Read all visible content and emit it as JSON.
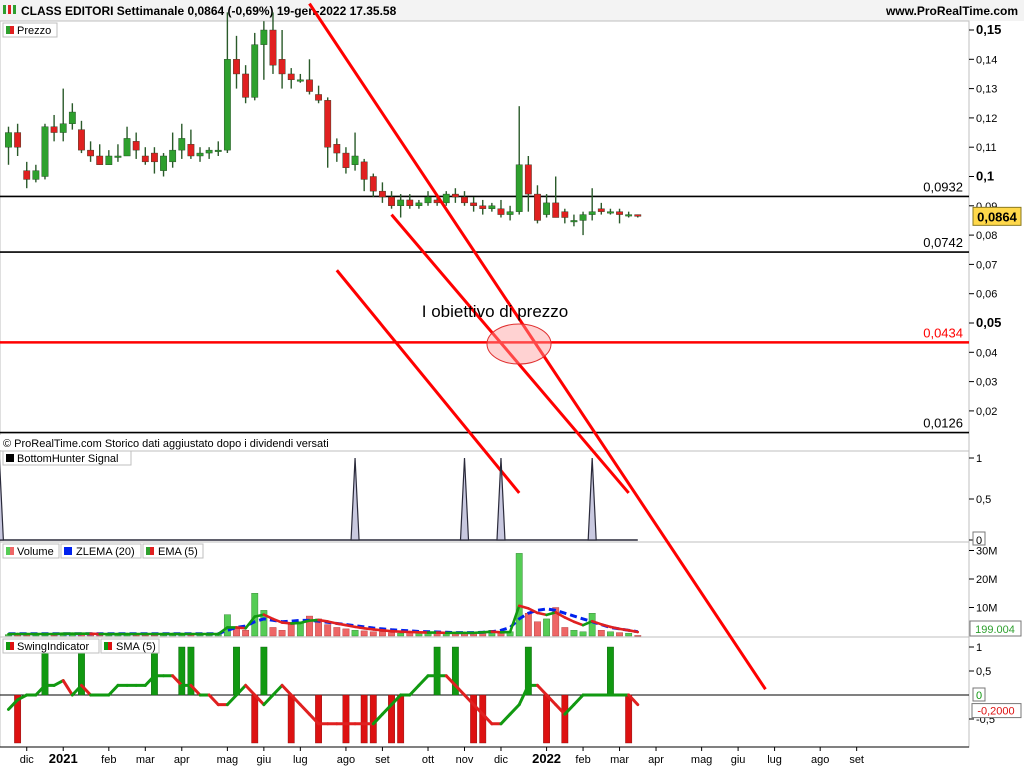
{
  "header": {
    "title": "CLASS EDITORI Settimanale 0,0864 (-0,69%) 19-gen-2022 17.35.58",
    "site": "www.ProRealTime.com"
  },
  "colors": {
    "up": "#2ea02e",
    "down": "#e02020",
    "channel": "#ff0000",
    "level": "#000000",
    "price_badge": "#ffd84a",
    "zlema": "#0022ee",
    "volume_up": "#55cc55",
    "volume_down": "#ee6666",
    "swing_up": "#119911",
    "swing_down": "#dd1111",
    "bottom_fill": "#c9c9e0"
  },
  "chart_data": [
    {
      "type": "candlestick",
      "panel": "Prezzo",
      "legend": [
        "Prezzo"
      ],
      "ylim": [
        0.0,
        0.15
      ],
      "yticks": [
        0.02,
        0.03,
        0.04,
        0.05,
        0.06,
        0.07,
        0.08,
        0.09,
        0.1,
        0.11,
        0.12,
        0.13,
        0.14,
        0.15
      ],
      "ytick_labels": [
        "0,02",
        "0,03",
        "0,04",
        "0,05",
        "0,06",
        "0,07",
        "0,08",
        "0,09",
        "0,1",
        "0,11",
        "0,12",
        "0,13",
        "0,14",
        "0,15"
      ],
      "bold_ticks": [
        0.05,
        0.1,
        0.15
      ],
      "last_price": 0.0864,
      "last_price_label": "0,0864",
      "levels": [
        {
          "value": 0.0932,
          "label": "0,0932",
          "color": "#000000"
        },
        {
          "value": 0.0742,
          "label": "0,0742",
          "color": "#000000"
        },
        {
          "value": 0.0434,
          "label": "0,0434",
          "color": "#ff0000"
        },
        {
          "value": 0.0126,
          "label": "0,0126",
          "color": "#000000"
        }
      ],
      "annotation": {
        "text": "I obiettivo di prezzo",
        "target_value": 0.0434
      },
      "footnote": "© ProRealTime.com Storico dati aggiustato dopo i dividendi versati",
      "candles": [
        {
          "o": 0.11,
          "h": 0.117,
          "l": 0.104,
          "c": 0.115
        },
        {
          "o": 0.115,
          "h": 0.118,
          "l": 0.107,
          "c": 0.11
        },
        {
          "o": 0.102,
          "h": 0.105,
          "l": 0.096,
          "c": 0.099
        },
        {
          "o": 0.099,
          "h": 0.104,
          "l": 0.098,
          "c": 0.102
        },
        {
          "o": 0.1,
          "h": 0.118,
          "l": 0.099,
          "c": 0.117
        },
        {
          "o": 0.117,
          "h": 0.121,
          "l": 0.112,
          "c": 0.115
        },
        {
          "o": 0.115,
          "h": 0.13,
          "l": 0.112,
          "c": 0.118
        },
        {
          "o": 0.118,
          "h": 0.125,
          "l": 0.116,
          "c": 0.122
        },
        {
          "o": 0.116,
          "h": 0.119,
          "l": 0.108,
          "c": 0.109
        },
        {
          "o": 0.109,
          "h": 0.112,
          "l": 0.105,
          "c": 0.107
        },
        {
          "o": 0.107,
          "h": 0.111,
          "l": 0.104,
          "c": 0.104
        },
        {
          "o": 0.104,
          "h": 0.109,
          "l": 0.104,
          "c": 0.107
        },
        {
          "o": 0.107,
          "h": 0.111,
          "l": 0.105,
          "c": 0.107
        },
        {
          "o": 0.107,
          "h": 0.117,
          "l": 0.107,
          "c": 0.113
        },
        {
          "o": 0.112,
          "h": 0.115,
          "l": 0.106,
          "c": 0.109
        },
        {
          "o": 0.107,
          "h": 0.11,
          "l": 0.104,
          "c": 0.105
        },
        {
          "o": 0.108,
          "h": 0.11,
          "l": 0.101,
          "c": 0.105
        },
        {
          "o": 0.102,
          "h": 0.108,
          "l": 0.1,
          "c": 0.107
        },
        {
          "o": 0.105,
          "h": 0.115,
          "l": 0.103,
          "c": 0.109
        },
        {
          "o": 0.109,
          "h": 0.118,
          "l": 0.106,
          "c": 0.113
        },
        {
          "o": 0.111,
          "h": 0.116,
          "l": 0.106,
          "c": 0.107
        },
        {
          "o": 0.107,
          "h": 0.11,
          "l": 0.105,
          "c": 0.108
        },
        {
          "o": 0.108,
          "h": 0.11,
          "l": 0.106,
          "c": 0.109
        },
        {
          "o": 0.109,
          "h": 0.112,
          "l": 0.107,
          "c": 0.109
        },
        {
          "o": 0.109,
          "h": 0.156,
          "l": 0.108,
          "c": 0.14
        },
        {
          "o": 0.14,
          "h": 0.148,
          "l": 0.13,
          "c": 0.135
        },
        {
          "o": 0.135,
          "h": 0.138,
          "l": 0.125,
          "c": 0.127
        },
        {
          "o": 0.127,
          "h": 0.149,
          "l": 0.126,
          "c": 0.145
        },
        {
          "o": 0.145,
          "h": 0.153,
          "l": 0.133,
          "c": 0.15
        },
        {
          "o": 0.15,
          "h": 0.156,
          "l": 0.135,
          "c": 0.138
        },
        {
          "o": 0.14,
          "h": 0.15,
          "l": 0.13,
          "c": 0.135
        },
        {
          "o": 0.135,
          "h": 0.137,
          "l": 0.13,
          "c": 0.133
        },
        {
          "o": 0.133,
          "h": 0.135,
          "l": 0.132,
          "c": 0.133
        },
        {
          "o": 0.133,
          "h": 0.14,
          "l": 0.128,
          "c": 0.129
        },
        {
          "o": 0.128,
          "h": 0.131,
          "l": 0.125,
          "c": 0.126
        },
        {
          "o": 0.126,
          "h": 0.127,
          "l": 0.103,
          "c": 0.11
        },
        {
          "o": 0.111,
          "h": 0.113,
          "l": 0.105,
          "c": 0.108
        },
        {
          "o": 0.108,
          "h": 0.11,
          "l": 0.101,
          "c": 0.103
        },
        {
          "o": 0.104,
          "h": 0.115,
          "l": 0.102,
          "c": 0.107
        },
        {
          "o": 0.105,
          "h": 0.106,
          "l": 0.095,
          "c": 0.099
        },
        {
          "o": 0.1,
          "h": 0.101,
          "l": 0.093,
          "c": 0.095
        },
        {
          "o": 0.095,
          "h": 0.098,
          "l": 0.091,
          "c": 0.093
        },
        {
          "o": 0.093,
          "h": 0.095,
          "l": 0.089,
          "c": 0.09
        },
        {
          "o": 0.09,
          "h": 0.094,
          "l": 0.086,
          "c": 0.092
        },
        {
          "o": 0.092,
          "h": 0.094,
          "l": 0.089,
          "c": 0.09
        },
        {
          "o": 0.09,
          "h": 0.092,
          "l": 0.089,
          "c": 0.091
        },
        {
          "o": 0.091,
          "h": 0.095,
          "l": 0.09,
          "c": 0.093
        },
        {
          "o": 0.092,
          "h": 0.094,
          "l": 0.09,
          "c": 0.091
        },
        {
          "o": 0.091,
          "h": 0.095,
          "l": 0.09,
          "c": 0.094
        },
        {
          "o": 0.094,
          "h": 0.096,
          "l": 0.091,
          "c": 0.093
        },
        {
          "o": 0.093,
          "h": 0.095,
          "l": 0.09,
          "c": 0.091
        },
        {
          "o": 0.091,
          "h": 0.093,
          "l": 0.088,
          "c": 0.09
        },
        {
          "o": 0.09,
          "h": 0.092,
          "l": 0.087,
          "c": 0.089
        },
        {
          "o": 0.089,
          "h": 0.091,
          "l": 0.088,
          "c": 0.09
        },
        {
          "o": 0.089,
          "h": 0.092,
          "l": 0.086,
          "c": 0.087
        },
        {
          "o": 0.087,
          "h": 0.09,
          "l": 0.085,
          "c": 0.088
        },
        {
          "o": 0.088,
          "h": 0.124,
          "l": 0.087,
          "c": 0.104
        },
        {
          "o": 0.104,
          "h": 0.107,
          "l": 0.088,
          "c": 0.094
        },
        {
          "o": 0.094,
          "h": 0.097,
          "l": 0.084,
          "c": 0.085
        },
        {
          "o": 0.087,
          "h": 0.094,
          "l": 0.086,
          "c": 0.091
        },
        {
          "o": 0.091,
          "h": 0.1,
          "l": 0.086,
          "c": 0.086
        },
        {
          "o": 0.088,
          "h": 0.089,
          "l": 0.084,
          "c": 0.086
        },
        {
          "o": 0.085,
          "h": 0.087,
          "l": 0.083,
          "c": 0.085
        },
        {
          "o": 0.085,
          "h": 0.088,
          "l": 0.08,
          "c": 0.087
        },
        {
          "o": 0.087,
          "h": 0.096,
          "l": 0.085,
          "c": 0.088
        },
        {
          "o": 0.089,
          "h": 0.091,
          "l": 0.087,
          "c": 0.088
        },
        {
          "o": 0.088,
          "h": 0.089,
          "l": 0.087,
          "c": 0.088
        },
        {
          "o": 0.088,
          "h": 0.089,
          "l": 0.084,
          "c": 0.087
        },
        {
          "o": 0.087,
          "h": 0.088,
          "l": 0.086,
          "c": 0.087
        },
        {
          "o": 0.087,
          "h": 0.087,
          "l": 0.086,
          "c": 0.0864
        }
      ],
      "channel_lines": [
        {
          "from": {
            "week": 33,
            "value": 0.159
          },
          "to": {
            "week": 83,
            "value": -0.075
          }
        },
        {
          "from": {
            "week": 42,
            "value": 0.087
          },
          "to": {
            "week": 68,
            "value": -0.008
          }
        },
        {
          "from": {
            "week": 36,
            "value": 0.068
          },
          "to": {
            "week": 56,
            "value": -0.008
          }
        }
      ]
    },
    {
      "type": "area",
      "panel": "BottomHunter Signal",
      "legend": [
        "BottomHunter Signal"
      ],
      "ylim": [
        0,
        1
      ],
      "ytick_labels": [
        "1",
        "0,5",
        "0"
      ],
      "spikes_at_week": [
        -1,
        38,
        50,
        54,
        64
      ],
      "series_length": 70
    },
    {
      "type": "bar",
      "panel": "Volume",
      "legend": [
        "Volume",
        "ZLEMA (20)",
        "EMA (5)"
      ],
      "ylim": [
        0,
        30
      ],
      "unit": "M",
      "ytick_labels": [
        "30M",
        "20M",
        "10M"
      ],
      "last_value_label": "199.004",
      "volume": [
        0.5,
        0.8,
        0.6,
        0.7,
        0.6,
        0.9,
        1.0,
        0.8,
        0.9,
        0.7,
        0.6,
        0.7,
        0.8,
        0.7,
        0.6,
        0.8,
        0.7,
        0.6,
        0.9,
        0.8,
        0.7,
        0.6,
        0.7,
        0.8,
        7.5,
        3.0,
        2.0,
        15.0,
        9.0,
        3.0,
        2.0,
        4.0,
        5.0,
        7.0,
        6.0,
        4.0,
        3.0,
        2.5,
        2.0,
        1.8,
        1.5,
        1.5,
        1.2,
        1.0,
        1.2,
        1.1,
        1.0,
        1.2,
        1.0,
        0.9,
        1.0,
        1.2,
        1.5,
        2.0,
        1.0,
        1.5,
        29.0,
        8.0,
        5.0,
        6.0,
        10.0,
        3.0,
        2.0,
        1.5,
        8.0,
        2.0,
        1.5,
        1.2,
        1.0,
        0.2
      ],
      "zlema": [
        0.8,
        0.8,
        0.8,
        0.8,
        0.8,
        0.8,
        0.8,
        0.8,
        0.8,
        0.8,
        0.8,
        0.8,
        0.8,
        0.8,
        0.8,
        0.8,
        0.8,
        0.8,
        0.8,
        0.8,
        0.8,
        0.8,
        0.8,
        0.8,
        2.0,
        3.0,
        3.5,
        5.0,
        6.0,
        5.5,
        5.0,
        5.2,
        5.5,
        5.5,
        5.2,
        4.8,
        4.4,
        4.0,
        3.6,
        3.2,
        2.8,
        2.5,
        2.2,
        2.0,
        1.8,
        1.6,
        1.5,
        1.4,
        1.3,
        1.2,
        1.2,
        1.2,
        1.3,
        1.5,
        2.0,
        3.0,
        6.0,
        8.0,
        9.0,
        9.5,
        9.0,
        8.0,
        7.0,
        6.0,
        5.0,
        4.0,
        3.0,
        2.5,
        2.0,
        1.5
      ],
      "ema": [
        0.7,
        0.7,
        0.7,
        0.7,
        0.7,
        0.7,
        0.8,
        0.8,
        0.8,
        0.8,
        0.7,
        0.7,
        0.7,
        0.7,
        0.7,
        0.7,
        0.7,
        0.7,
        0.7,
        0.7,
        0.7,
        0.7,
        0.7,
        0.7,
        3.0,
        3.0,
        2.7,
        6.8,
        7.5,
        6.0,
        4.7,
        4.4,
        4.6,
        5.4,
        5.6,
        5.1,
        4.4,
        3.8,
        3.2,
        2.7,
        2.3,
        2.0,
        1.7,
        1.5,
        1.4,
        1.3,
        1.2,
        1.2,
        1.1,
        1.1,
        1.1,
        1.1,
        1.3,
        1.5,
        1.3,
        1.4,
        10.6,
        9.7,
        8.1,
        7.4,
        8.3,
        6.5,
        5.0,
        3.8,
        5.2,
        4.1,
        3.2,
        2.5,
        2.0,
        1.4
      ]
    },
    {
      "type": "bar",
      "panel": "SwingIndicator",
      "legend": [
        "SwingIndicator",
        "SMA (5)"
      ],
      "ylim": [
        -1,
        1
      ],
      "ytick_labels": [
        "1",
        "0,5",
        "0",
        "-0,5"
      ],
      "last_value_label": "-0,2000",
      "zero_label": "0",
      "swing": [
        0,
        -1,
        0,
        0,
        1,
        0,
        0,
        0,
        1,
        0,
        0,
        0,
        0,
        0,
        0,
        0,
        1,
        0,
        0,
        1,
        1,
        0,
        0,
        0,
        0,
        1,
        0,
        -1,
        1,
        0,
        0,
        -1,
        0,
        0,
        -1,
        0,
        0,
        -1,
        0,
        -1,
        -1,
        0,
        -1,
        -1,
        0,
        0,
        0,
        1,
        0,
        1,
        0,
        -1,
        -1,
        0,
        0,
        0,
        0,
        1,
        0,
        -1,
        0,
        -1,
        0,
        0,
        0,
        0,
        1,
        0,
        -1,
        0
      ],
      "sma": [
        -0.3,
        -0.1,
        0.0,
        0.0,
        0.2,
        0.2,
        0.3,
        0.0,
        0.2,
        0.0,
        0.0,
        0.0,
        0.2,
        0.2,
        0.2,
        0.2,
        0.4,
        0.4,
        0.4,
        0.2,
        0.2,
        0.0,
        0.0,
        -0.2,
        -0.2,
        0.0,
        0.2,
        0.0,
        -0.2,
        0.0,
        0.2,
        0.0,
        -0.2,
        -0.4,
        -0.6,
        -0.6,
        -0.6,
        -0.6,
        -0.6,
        -0.6,
        -0.6,
        -0.4,
        -0.2,
        0.0,
        0.0,
        0.2,
        0.4,
        0.4,
        0.4,
        0.2,
        0.0,
        -0.2,
        -0.4,
        -0.6,
        -0.6,
        -0.4,
        -0.2,
        0.2,
        0.2,
        0.0,
        -0.2,
        -0.4,
        -0.2,
        0.0,
        0.0,
        0.0,
        0.0,
        0.0,
        0.0,
        -0.2
      ]
    }
  ],
  "x_axis": {
    "labels": [
      {
        "week": -2,
        "text": "nov"
      },
      {
        "week": 2,
        "text": "dic"
      },
      {
        "week": 6,
        "text": "2021",
        "bold": true
      },
      {
        "week": 11,
        "text": "feb"
      },
      {
        "week": 15,
        "text": "mar"
      },
      {
        "week": 19,
        "text": "apr"
      },
      {
        "week": 24,
        "text": "mag"
      },
      {
        "week": 28,
        "text": "giu"
      },
      {
        "week": 32,
        "text": "lug"
      },
      {
        "week": 37,
        "text": "ago"
      },
      {
        "week": 41,
        "text": "set"
      },
      {
        "week": 46,
        "text": "ott"
      },
      {
        "week": 50,
        "text": "nov"
      },
      {
        "week": 54,
        "text": "dic"
      },
      {
        "week": 59,
        "text": "2022",
        "bold": true
      },
      {
        "week": 63,
        "text": "feb"
      },
      {
        "week": 67,
        "text": "mar"
      },
      {
        "week": 71,
        "text": "apr"
      },
      {
        "week": 76,
        "text": "mag"
      },
      {
        "week": 80,
        "text": "giu"
      },
      {
        "week": 84,
        "text": "lug"
      },
      {
        "week": 89,
        "text": "ago"
      },
      {
        "week": 93,
        "text": "set"
      }
    ]
  }
}
